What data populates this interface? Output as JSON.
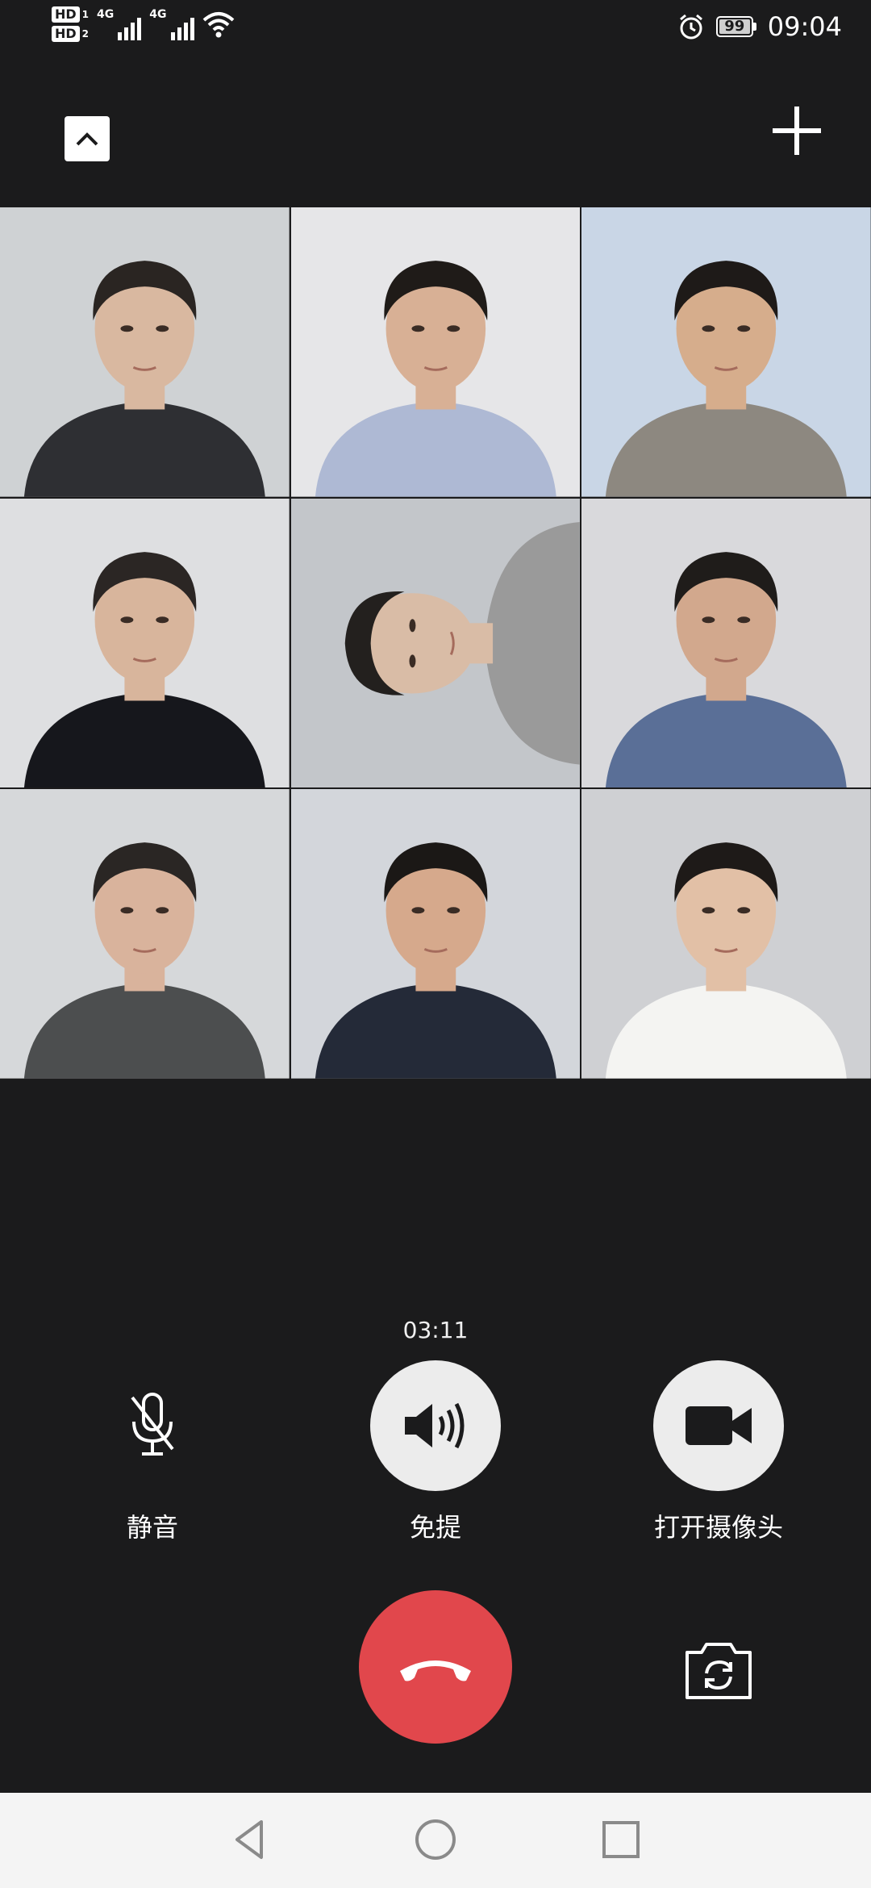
{
  "status_bar": {
    "hd1": "HD",
    "hd1_sub": "1",
    "hd2": "HD",
    "hd2_sub": "2",
    "net1": "4G",
    "net2": "4G",
    "battery": "99",
    "time": "09:04",
    "icons": [
      "alarm-icon",
      "wifi-icon",
      "signal-icon"
    ]
  },
  "top": {
    "collapse_icon": "chevron-up-icon",
    "add_icon": "plus-icon"
  },
  "participants": [
    {
      "id": "p1",
      "bg": "#cfd2d4",
      "shirt": "#2e2f33",
      "skin": "#d9b8a0",
      "hair": "#2a2522"
    },
    {
      "id": "p2",
      "bg": "#e6e6e8",
      "shirt": "#aeb9d4",
      "skin": "#d8b095",
      "hair": "#1f1b18"
    },
    {
      "id": "p3",
      "bg": "#c9d6e6",
      "shirt": "#8d8880",
      "skin": "#d6ad8c",
      "hair": "#1e1a18"
    },
    {
      "id": "p4",
      "bg": "#dedfe1",
      "shirt": "#16171c",
      "skin": "#d8b59c",
      "hair": "#2b2624"
    },
    {
      "id": "p5",
      "bg": "#c3c6ca",
      "shirt": "#9a9a9a",
      "skin": "#d9bca6",
      "hair": "#23201e"
    },
    {
      "id": "p6",
      "bg": "#d9d9dc",
      "shirt": "#5a6f97",
      "skin": "#d2a88d",
      "hair": "#1f1c1a"
    },
    {
      "id": "p7",
      "bg": "#d6d8da",
      "shirt": "#4c4e4f",
      "skin": "#d9b39c",
      "hair": "#2a2624"
    },
    {
      "id": "p8",
      "bg": "#d3d6db",
      "shirt": "#242a38",
      "skin": "#d6a98c",
      "hair": "#1b1816"
    },
    {
      "id": "p9",
      "bg": "#cfd0d3",
      "shirt": "#f4f4f2",
      "skin": "#e2c0a6",
      "hair": "#1e1a18"
    }
  ],
  "call": {
    "timer": "03:11",
    "mute_label": "静音",
    "speaker_label": "免提",
    "camera_label": "打开摄像头",
    "hangup_icon": "phone-hangup-icon",
    "flip_icon": "camera-flip-icon"
  },
  "nav": {
    "icons": [
      "back-triangle-icon",
      "home-circle-icon",
      "recents-square-icon"
    ]
  },
  "colors": {
    "background": "#1b1b1c",
    "hangup": "#e1474c",
    "button_fill": "#ececec",
    "navbar": "#f4f4f4"
  }
}
